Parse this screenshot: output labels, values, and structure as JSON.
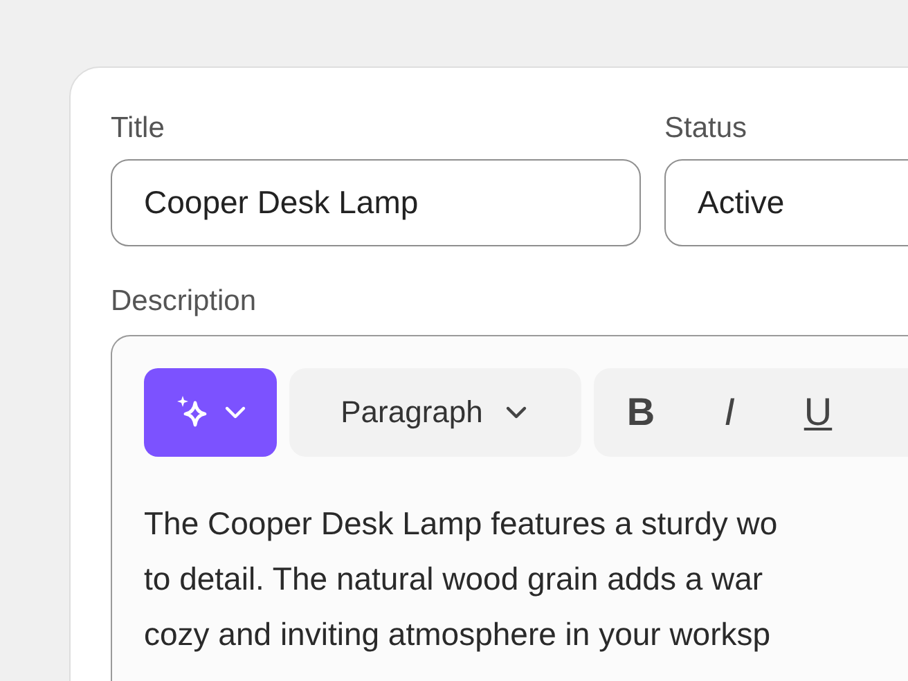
{
  "title_field": {
    "label": "Title",
    "value": "Cooper Desk Lamp"
  },
  "status_field": {
    "label": "Status",
    "value": "Active"
  },
  "description": {
    "label": "Description",
    "toolbar": {
      "paragraph_style": "Paragraph",
      "format_buttons": [
        {
          "kind": "bold",
          "label": "B"
        },
        {
          "kind": "italic",
          "label": "I"
        },
        {
          "kind": "underline",
          "label": "U"
        }
      ]
    },
    "lines": [
      "The Cooper Desk Lamp features a sturdy wo",
      "to detail. The natural wood grain adds a war",
      "cozy and inviting atmosphere in your worksp"
    ]
  }
}
